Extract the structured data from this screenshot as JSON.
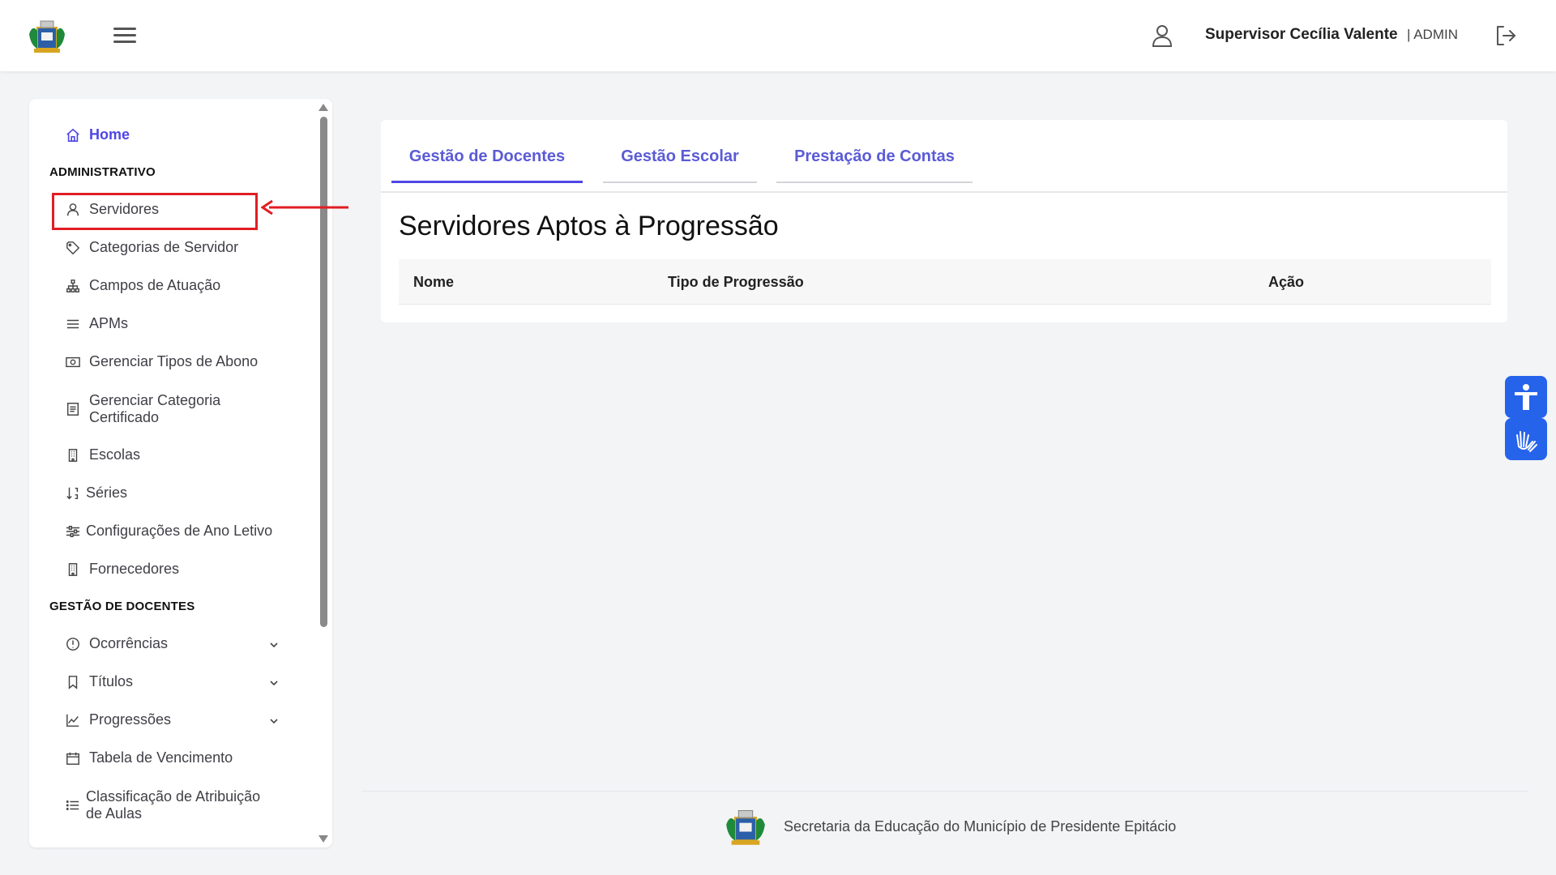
{
  "header": {
    "user_name": "Supervisor Cecília Valente",
    "user_role": "| ADMIN"
  },
  "sidebar": {
    "home": "Home",
    "sections": [
      {
        "title": "ADMINISTRATIVO",
        "items": [
          {
            "label": "Servidores",
            "icon": "user-icon"
          },
          {
            "label": "Categorias de Servidor",
            "icon": "tag-icon"
          },
          {
            "label": "Campos de Atuação",
            "icon": "sitemap-icon"
          },
          {
            "label": "APMs",
            "icon": "list-icon"
          },
          {
            "label": "Gerenciar Tipos de Abono",
            "icon": "money-icon"
          },
          {
            "label": "Gerenciar Categoria Certificado",
            "icon": "document-icon"
          },
          {
            "label": "Escolas",
            "icon": "building-icon"
          },
          {
            "label": "Séries",
            "icon": "sort-icon"
          },
          {
            "label": "Configurações de Ano Letivo",
            "icon": "sliders-icon"
          },
          {
            "label": "Fornecedores",
            "icon": "building-icon"
          }
        ]
      },
      {
        "title": "GESTÃO DE DOCENTES",
        "items": [
          {
            "label": "Ocorrências",
            "icon": "alert-circle-icon"
          },
          {
            "label": "Títulos",
            "icon": "bookmark-icon"
          },
          {
            "label": "Progressões",
            "icon": "chart-line-icon"
          },
          {
            "label": "Tabela de Vencimento",
            "icon": "calendar-icon"
          },
          {
            "label": "Classificação de Atribuição de Aulas",
            "icon": "list-icon"
          }
        ]
      }
    ]
  },
  "tabs": [
    {
      "label": "Gestão de Docentes",
      "active": true
    },
    {
      "label": "Gestão Escolar",
      "active": false
    },
    {
      "label": "Prestação de Contas",
      "active": false
    }
  ],
  "main": {
    "title": "Servidores Aptos à Progressão",
    "columns": [
      "Nome",
      "Tipo de Progressão",
      "Ação"
    ]
  },
  "footer": {
    "text": "Secretaria da Educação do Município de Presidente Epitácio"
  },
  "colors": {
    "accent": "#4f46e5",
    "highlight": "#e11d24",
    "accessibility": "#2563eb"
  }
}
